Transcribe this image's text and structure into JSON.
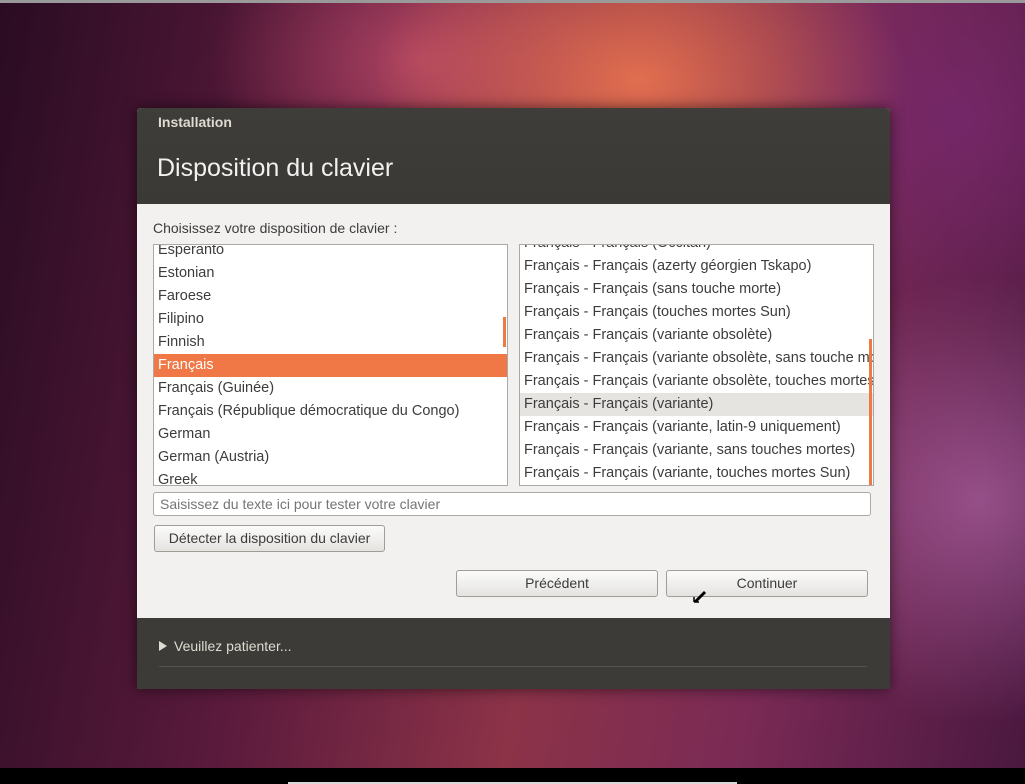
{
  "window": {
    "title": "Installation",
    "page_title": "Disposition du clavier"
  },
  "main": {
    "prompt": "Choisissez votre disposition de clavier :",
    "layouts": [
      "Esperanto",
      "Estonian",
      "Faroese",
      "Filipino",
      "Finnish",
      "Français",
      "Français (Guinée)",
      "Français (République démocratique du Congo)",
      "German",
      "German (Austria)",
      "Greek"
    ],
    "selected_layout": "Français",
    "variants": [
      "Français - Français (Occitan)",
      "Français - Français (azerty géorgien Tskapo)",
      "Français - Français (sans touche morte)",
      "Français - Français (touches mortes Sun)",
      "Français - Français (variante obsolète)",
      "Français - Français (variante obsolète, sans touche morte)",
      "Français - Français (variante obsolète, touches mortes Sun)",
      "Français - Français (variante)",
      "Français - Français (variante, latin-9 uniquement)",
      "Français - Français (variante, sans touches mortes)",
      "Français - Français (variante, touches mortes Sun)"
    ],
    "selected_variant": "Français - Français (variante)",
    "test_input": {
      "placeholder": "Saisissez du texte ici pour tester votre clavier",
      "value": ""
    },
    "detect_button": "Détecter la disposition du clavier",
    "previous_button": "Précédent",
    "continue_button": "Continuer"
  },
  "footer": {
    "expander_label": "Veuillez patienter..."
  },
  "colors": {
    "accent": "#f07746",
    "titlebar": "#3c3b37",
    "window_bg": "#f2f1f0"
  }
}
